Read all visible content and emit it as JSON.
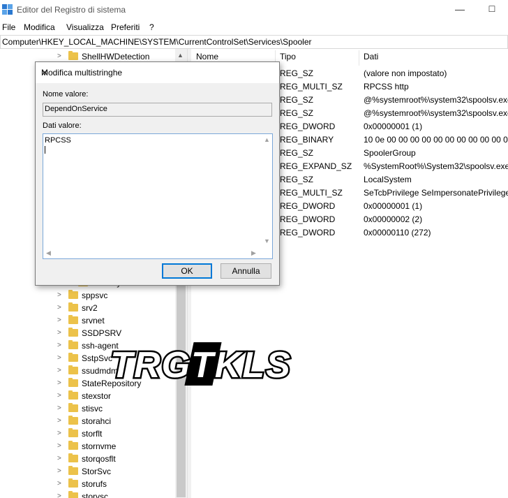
{
  "window": {
    "title": "Editor del Registro di sistema",
    "minimize": "—",
    "maximize": "☐",
    "close": "✕"
  },
  "menu": [
    "File",
    "Modifica",
    "Visualizza",
    "Preferiti",
    "?"
  ],
  "address": "Computer\\HKEY_LOCAL_MACHINE\\SYSTEM\\CurrentControlSet\\Services\\Spooler",
  "tree": {
    "top_item": "ShellHWDetection",
    "partial_item": "security",
    "items": [
      "sppsvc",
      "srv2",
      "srvnet",
      "SSDPSRV",
      "ssh-agent",
      "SstpSvc",
      "ssudmdm",
      "StateRepository",
      "stexstor",
      "stisvc",
      "storahci",
      "storflt",
      "stornvme",
      "storqosflt",
      "StorSvc",
      "storufs",
      "storvsc"
    ]
  },
  "list": {
    "headers": {
      "name": "Nome",
      "type": "Tipo",
      "data": "Dati"
    },
    "rows": [
      {
        "type": "REG_SZ",
        "data": "(valore non impostato)"
      },
      {
        "type": "REG_MULTI_SZ",
        "data": "RPCSS http"
      },
      {
        "type": "REG_SZ",
        "data": "@%systemroot%\\system32\\spoolsv.exe"
      },
      {
        "type": "REG_SZ",
        "data": "@%systemroot%\\system32\\spoolsv.exe"
      },
      {
        "type": "REG_DWORD",
        "data": "0x00000001 (1)"
      },
      {
        "type": "REG_BINARY",
        "data": "10 0e 00 00 00 00 00 00 00 00 00 00 03 00"
      },
      {
        "type": "REG_SZ",
        "data": "SpoolerGroup"
      },
      {
        "type": "REG_EXPAND_SZ",
        "data": "%SystemRoot%\\System32\\spoolsv.exe"
      },
      {
        "type": "REG_SZ",
        "data": "LocalSystem"
      },
      {
        "type": "REG_MULTI_SZ",
        "data": "SeTcbPrivilege SeImpersonatePrivilege S"
      },
      {
        "type": "REG_DWORD",
        "data": "0x00000001 (1)"
      },
      {
        "type": "REG_DWORD",
        "data": "0x00000002 (2)"
      },
      {
        "type": "REG_DWORD",
        "data": "0x00000110 (272)"
      }
    ]
  },
  "dialog": {
    "title": "Modifica multistringhe",
    "close": "✕",
    "name_label": "Nome valore:",
    "name_value": "DependOnService",
    "data_label": "Dati valore:",
    "data_value": "RPCSS",
    "ok": "OK",
    "cancel": "Annulla"
  },
  "watermark": {
    "text": "TRGTKLS"
  }
}
